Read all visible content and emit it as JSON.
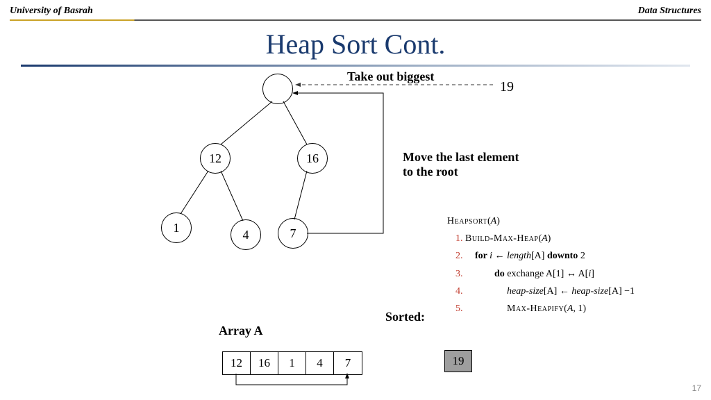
{
  "header": {
    "left": "University of Basrah",
    "right": "Data Structures"
  },
  "title": "Heap Sort Cont.",
  "annotations": {
    "takeout": "Take out biggest",
    "big19": "19",
    "move": "Move the last element\nto the root",
    "arrayA": "Array A",
    "sorted": "Sorted:"
  },
  "tree": {
    "root": "",
    "n12": "12",
    "n16": "16",
    "n1": "1",
    "n4": "4",
    "n7": "7"
  },
  "array": [
    "12",
    "16",
    "1",
    "4",
    "7"
  ],
  "sorted_values": [
    "19"
  ],
  "algorithm": {
    "name": "Heapsort",
    "arg": "A",
    "steps": {
      "s1a": "Build-Max-Heap",
      "s1b": "(",
      "s1c": "A",
      "s1d": ")",
      "s2a": "for ",
      "s2b": "i",
      "s2c": " ← ",
      "s2d": "length",
      "s2e": "[A]  ",
      "s2f": "downto",
      "s2g": " 2",
      "s3a": "do",
      "s3b": " exchange A[1] ↔ A[",
      "s3c": "i",
      "s3d": "]",
      "s4a": "heap-size",
      "s4b": "[A] ← ",
      "s4c": "heap-size",
      "s4d": "[A] −1",
      "s5a": "Max-Heapify",
      "s5b": "(",
      "s5c": "A",
      "s5d": ", 1)"
    }
  },
  "page": "17"
}
